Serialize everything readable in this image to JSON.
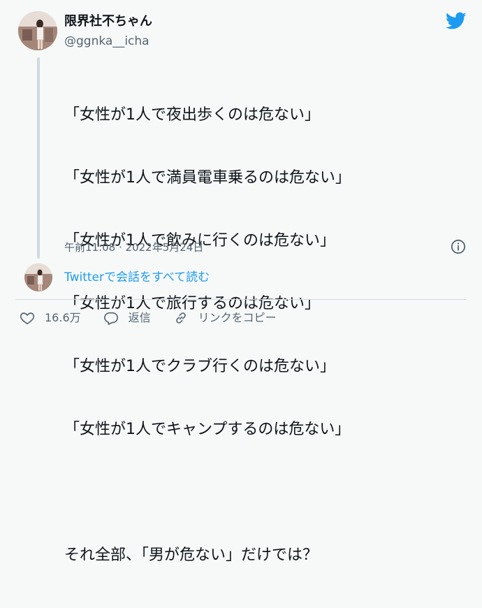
{
  "author": {
    "name": "限界社不ちゃん",
    "handle": "@ggnka__icha"
  },
  "tweet": {
    "lines": [
      "「女性が1人で夜出歩くのは危ない」",
      "「女性が1人で満員電車乗るのは危ない」",
      "「女性が1人で飲みに行くのは危ない」",
      "「女性が1人で旅行するのは危ない」",
      "「女性が1人でクラブ行くのは危ない」",
      "「女性が1人でキャンプするのは危ない」"
    ],
    "closing": "それ全部、「男が危ない」だけでは？",
    "timestamp": "午前11:08 · 2022年5月24日"
  },
  "thread_link": "Twitterで会話をすべて読む",
  "actions": {
    "like_count": "16.6万",
    "reply_label": "返信",
    "copy_link_label": "リンクをコピー"
  },
  "icons": {
    "brand": "twitter-bird-icon",
    "info": "info-icon",
    "like": "heart-icon",
    "reply": "speech-bubble-icon",
    "link": "link-icon"
  },
  "colors": {
    "brand": "#1d9bf0",
    "muted_text": "#536471",
    "text": "#0f1419",
    "background": "#f7f9f9",
    "line": "#cfd9de"
  }
}
